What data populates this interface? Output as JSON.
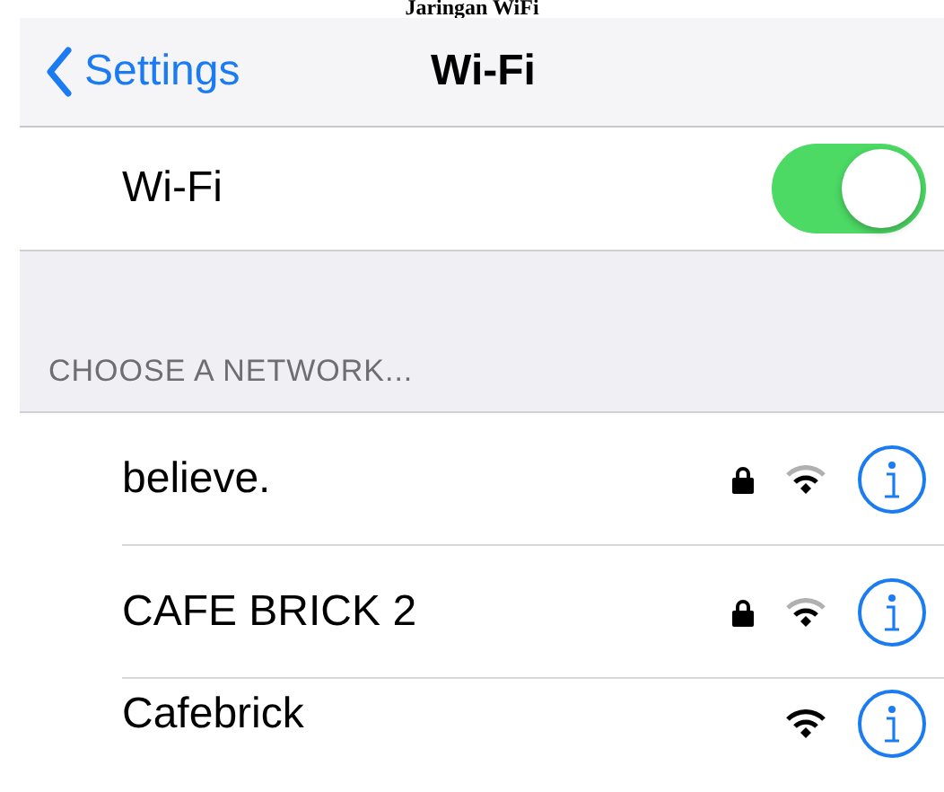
{
  "caption": "Jaringan WiFi",
  "nav": {
    "back": "Settings",
    "title": "Wi-Fi"
  },
  "wifi": {
    "label": "Wi-Fi",
    "on": true
  },
  "section": "CHOOSE A NETWORK...",
  "networks": [
    {
      "name": "believe.",
      "locked": true,
      "full_signal": false
    },
    {
      "name": "CAFE BRICK 2",
      "locked": true,
      "full_signal": false
    },
    {
      "name": "Cafebrick",
      "locked": false,
      "full_signal": true
    }
  ]
}
